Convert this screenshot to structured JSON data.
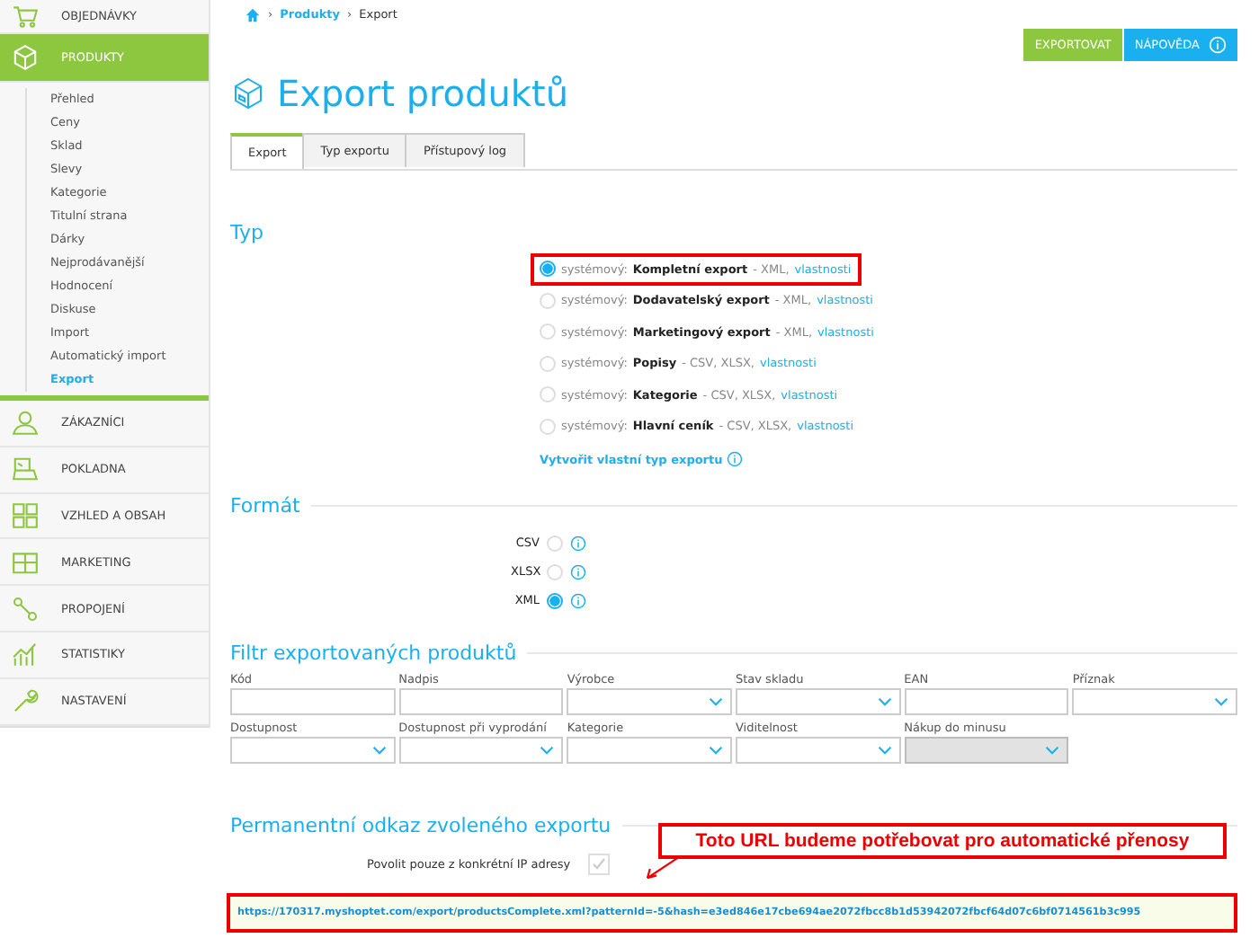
{
  "sidebar": {
    "items": [
      {
        "label": "OBJEDNÁVKY",
        "selected": false
      },
      {
        "label": "PRODUKTY",
        "selected": true,
        "children": [
          {
            "label": "Přehled",
            "selected": false
          },
          {
            "label": "Ceny",
            "selected": false
          },
          {
            "label": "Sklad",
            "selected": false
          },
          {
            "label": "Slevy",
            "selected": false
          },
          {
            "label": "Kategorie",
            "selected": false
          },
          {
            "label": "Titulní strana",
            "selected": false
          },
          {
            "label": "Dárky",
            "selected": false
          },
          {
            "label": "Nejprodávanější",
            "selected": false
          },
          {
            "label": "Hodnocení",
            "selected": false
          },
          {
            "label": "Diskuse",
            "selected": false
          },
          {
            "label": "Import",
            "selected": false
          },
          {
            "label": "Automatický import",
            "selected": false
          },
          {
            "label": "Export",
            "selected": true
          }
        ]
      },
      {
        "label": "ZÁKAZNÍCI",
        "selected": false
      },
      {
        "label": "POKLADNA",
        "selected": false
      },
      {
        "label": "VZHLED A OBSAH",
        "selected": false
      },
      {
        "label": "MARKETING",
        "selected": false
      },
      {
        "label": "PROPOJENÍ",
        "selected": false
      },
      {
        "label": "STATISTIKY",
        "selected": false
      },
      {
        "label": "NASTAVENÍ",
        "selected": false
      }
    ]
  },
  "breadcrumb": [
    {
      "separator": "›",
      "label": "Produkty",
      "current": false
    },
    {
      "separator": "›",
      "label": "Export",
      "current": true
    }
  ],
  "buttons": [
    {
      "label": "EXPORTOVAT",
      "kind": "primary"
    },
    {
      "label": "NÁPOVĚDA",
      "kind": "help"
    }
  ],
  "page_title": "Export produktů",
  "tabs": [
    {
      "label": "Export",
      "selected": true
    },
    {
      "label": "Typ exportu",
      "selected": false
    },
    {
      "label": "Přístupový log",
      "selected": false
    }
  ],
  "type_section": {
    "heading": "Typ",
    "options": [
      {
        "prefix": "systémový:",
        "name": "Kompletní export",
        "formats": "- XML,",
        "link": "vlastnosti",
        "selected": true,
        "annotated": true
      },
      {
        "prefix": "systémový:",
        "name": "Dodavatelský export",
        "formats": "- XML,",
        "link": "vlastnosti",
        "selected": false,
        "annotated": false
      },
      {
        "prefix": "systémový:",
        "name": "Marketingový export",
        "formats": "- XML,",
        "link": "vlastnosti",
        "selected": false,
        "annotated": false
      },
      {
        "prefix": "systémový:",
        "name": "Popisy",
        "formats": "- CSV, XLSX,",
        "link": "vlastnosti",
        "selected": false,
        "annotated": false
      },
      {
        "prefix": "systémový:",
        "name": "Kategorie",
        "formats": "- CSV, XLSX,",
        "link": "vlastnosti",
        "selected": false,
        "annotated": false
      },
      {
        "prefix": "systémový:",
        "name": "Hlavní ceník",
        "formats": "- CSV, XLSX,",
        "link": "vlastnosti",
        "selected": false,
        "annotated": false
      }
    ],
    "create_link": "Vytvořit vlastní typ exportu"
  },
  "format_section": {
    "heading": "Formát",
    "options": [
      {
        "label": "CSV",
        "selected": false
      },
      {
        "label": "XLSX",
        "selected": false
      },
      {
        "label": "XML",
        "selected": true
      }
    ]
  },
  "filter_section": {
    "heading": "Filtr exportovaných produktů",
    "fields": [
      {
        "label": "Kód",
        "kind": "text",
        "disabled": false
      },
      {
        "label": "Nadpis",
        "kind": "text",
        "disabled": false
      },
      {
        "label": "Výrobce",
        "kind": "select",
        "disabled": false
      },
      {
        "label": "Stav skladu",
        "kind": "select",
        "disabled": false
      },
      {
        "label": "EAN",
        "kind": "text",
        "disabled": false
      },
      {
        "label": "Příznak",
        "kind": "select",
        "disabled": false
      },
      {
        "label": "Dostupnost",
        "kind": "select",
        "disabled": false
      },
      {
        "label": "Dostupnost při vyprodání",
        "kind": "select",
        "disabled": false
      },
      {
        "label": "Kategorie",
        "kind": "select",
        "disabled": false
      },
      {
        "label": "Viditelnost",
        "kind": "select",
        "disabled": false
      },
      {
        "label": "Nákup do minusu",
        "kind": "select",
        "disabled": true
      }
    ]
  },
  "link_section": {
    "heading": "Permanentní odkaz zvoleného exportu",
    "ip_label": "Povolit pouze z konkrétní IP adresy",
    "ip_checked": false,
    "url": "https://170317.myshoptet.com/export/productsComplete.xml?patternId=-5&hash=e3ed846e17cbe694ae2072fbcc8b1d53942072fbcf64d07c6bf0714561b3c995",
    "url_annotated": true
  },
  "callout": "Toto URL budeme potřebovat pro automatické přenosy"
}
